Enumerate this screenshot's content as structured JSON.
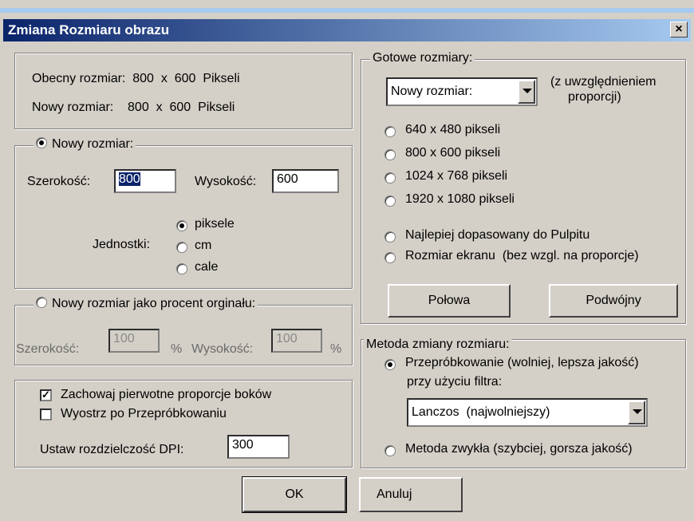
{
  "window": {
    "title": "Zmiana Rozmiaru obrazu",
    "close_label": "×"
  },
  "current": {
    "obecny": "Obecny rozmiar:  800  x  600  Pikseli",
    "nowy": "Nowy rozmiar:    800  x  600  Pikseli"
  },
  "new_size": {
    "title": "Nowy rozmiar:",
    "width_label": "Szerokość:",
    "width_value": "800",
    "height_label": "Wysokość:",
    "height_value": "600",
    "units_label": "Jednostki:",
    "units": [
      "piksele",
      "cm",
      "cale"
    ],
    "selected_unit": "piksele"
  },
  "percent": {
    "title": "Nowy rozmiar jako procent orginału:",
    "width_label": "Szerokość:",
    "width_value": "100",
    "pct": "%",
    "height_label": "Wysokość:",
    "height_value": "100"
  },
  "options": {
    "keep_ratio": "Zachowaj pierwotne proporcje boków",
    "sharpen": "Wyostrz po Przepróbkowaniu",
    "dpi_label": "Ustaw rozdzielczość DPI:",
    "dpi_value": "300"
  },
  "presets": {
    "title": "Gotowe rozmiary:",
    "combo_value": "Nowy rozmiar:",
    "combo_note_1": "(z uwzględnieniem",
    "combo_note_2": "proporcji)",
    "items": [
      "640 x 480 pikseli",
      "800 x 600 pikseli",
      "1024 x 768 pikseli",
      "1920 x 1080 pikseli"
    ],
    "fit_desktop": "Najlepiej dopasowany do Pulpitu",
    "screen_size": "Rozmiar ekranu  (bez wzgl. na proporcje)",
    "half_button": "Połowa",
    "double_button": "Podwójny"
  },
  "method": {
    "title": "Metoda zmiany rozmiaru:",
    "resample": "Przepróbkowanie (wolniej, lepsza jakość)",
    "filter_label": "przy użyciu filtra:",
    "filter_value": "Lanczos  (najwolniejszy)",
    "simple": "Metoda zwykła (szybciej, gorsza jakość)"
  },
  "footer": {
    "ok": "OK",
    "cancel": "Anuluj"
  }
}
